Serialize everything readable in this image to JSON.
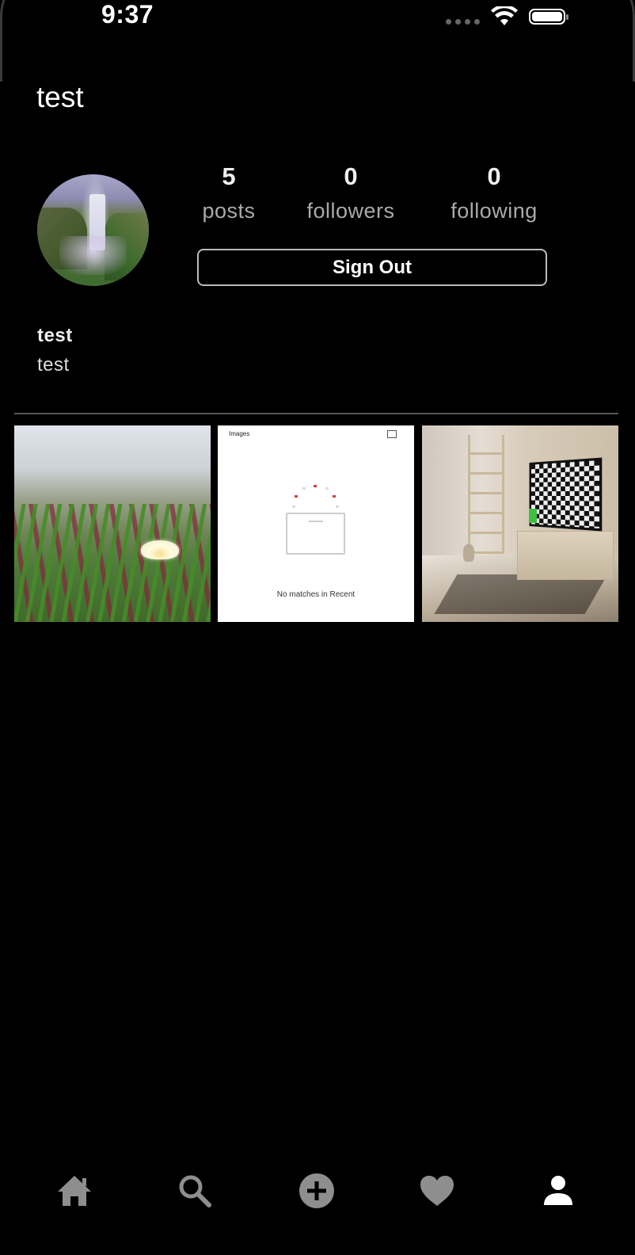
{
  "status_bar": {
    "time": "9:37"
  },
  "header": {
    "title": "test"
  },
  "profile": {
    "stats": [
      {
        "value": "5",
        "label": "posts"
      },
      {
        "value": "0",
        "label": "followers"
      },
      {
        "value": "0",
        "label": "following"
      }
    ],
    "sign_out_label": "Sign Out",
    "name": "test",
    "bio": "test"
  },
  "posts": {
    "tiles": [
      {
        "icon": "flower-photo"
      },
      {
        "header_label": "Images",
        "empty_message": "No matches in Recent"
      },
      {
        "icon": "room-tv-photo"
      }
    ]
  },
  "tabbar": {
    "icons": [
      "home-icon",
      "search-icon",
      "add-post-icon",
      "heart-icon",
      "profile-icon"
    ],
    "active": "profile-icon"
  }
}
